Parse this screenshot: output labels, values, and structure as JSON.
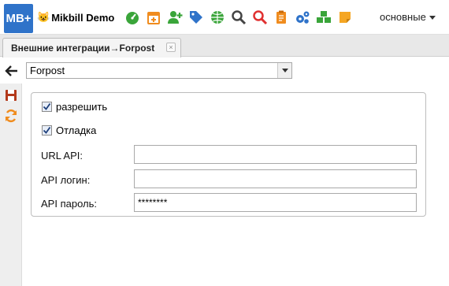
{
  "header": {
    "logo_text": "MB+",
    "brand_icon": "😺",
    "brand_name": "Mikbill Demo",
    "icons": [
      {
        "name": "dashboard-icon",
        "color": "#3aa53a"
      },
      {
        "name": "calendar-icon",
        "color": "#f08c1e"
      },
      {
        "name": "add-user-icon",
        "color": "#3aa53a"
      },
      {
        "name": "tags-icon",
        "color": "#2f73c9"
      },
      {
        "name": "globe-icon",
        "color": "#3aa53a"
      },
      {
        "name": "search-icon",
        "color": "#444444"
      },
      {
        "name": "search-red-icon",
        "color": "#e03030"
      },
      {
        "name": "clipboard-icon",
        "color": "#f08c1e"
      },
      {
        "name": "gears-icon",
        "color": "#2f73c9"
      },
      {
        "name": "cubes-icon",
        "color": "#3aa53a"
      },
      {
        "name": "sticky-note-icon",
        "color": "#f5a623"
      }
    ],
    "menu_label": "основные"
  },
  "tabs": [
    {
      "label": "Внешние интеграции→Forpost",
      "close": "×"
    }
  ],
  "toolbar": {
    "selected_integration": "Forpost"
  },
  "form": {
    "enable_label": "разрешить",
    "enable_checked": true,
    "debug_label": "Отладка",
    "debug_checked": true,
    "url_label": "URL API:",
    "url_value": "",
    "login_label": "API логин:",
    "login_value": "",
    "password_label": "API пароль:",
    "password_value": "********"
  }
}
